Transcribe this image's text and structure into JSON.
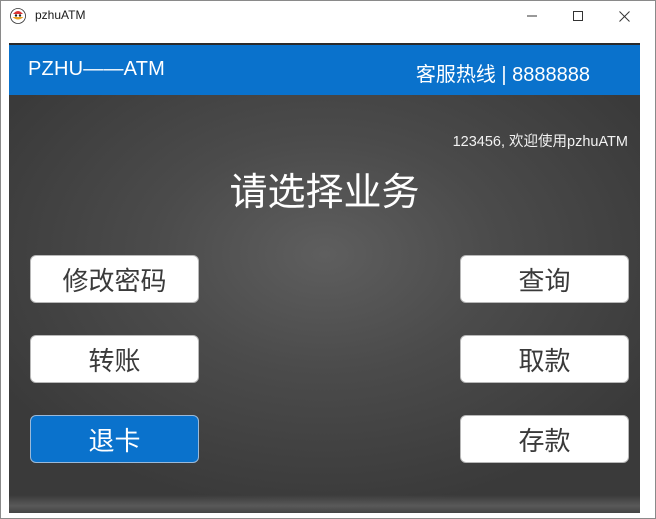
{
  "window": {
    "title": "pzhuATM"
  },
  "header": {
    "brand": "PZHU——ATM",
    "hotline": "客服热线 | 8888888"
  },
  "main": {
    "welcome": "123456, 欢迎使用pzhuATM",
    "prompt": "请选择业务"
  },
  "buttons": {
    "change_password": "修改密码",
    "query": "查询",
    "transfer": "转账",
    "withdraw": "取款",
    "eject_card": "退卡",
    "deposit": "存款"
  },
  "colors": {
    "accent": "#0a72cc",
    "background": "#4b4b4b",
    "button_bg": "#ffffff"
  }
}
